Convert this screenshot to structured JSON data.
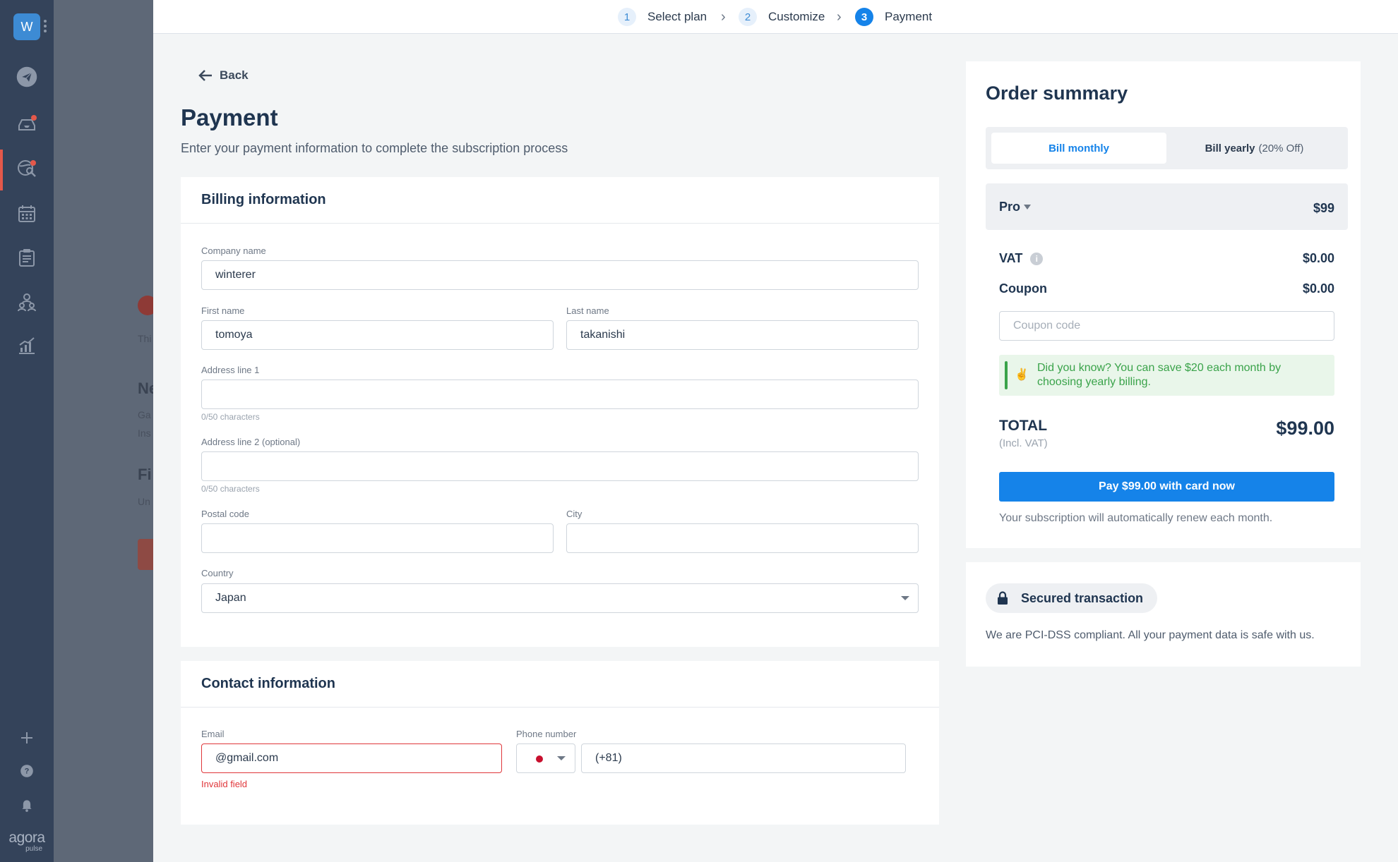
{
  "left_nav": {
    "workspace_initial": "W",
    "brand": "agora",
    "brand_sub": "pulse",
    "icons": [
      "paper-plane-icon",
      "inbox-icon",
      "listening-icon",
      "calendar-icon",
      "report-icon",
      "team-icon",
      "analytics-icon",
      "plus-icon",
      "help-icon",
      "bell-icon"
    ]
  },
  "background_page": {
    "fragments": [
      "Thi",
      "Ne",
      "Ga",
      "Ins",
      "Fi",
      "Un"
    ]
  },
  "stepper": {
    "steps": [
      {
        "number": "1",
        "label": "Select plan"
      },
      {
        "number": "2",
        "label": "Customize"
      },
      {
        "number": "3",
        "label": "Payment"
      }
    ],
    "active_step": 3
  },
  "header": {
    "back_label": "Back",
    "title": "Payment",
    "subtitle": "Enter your payment information to complete the subscription process"
  },
  "billing": {
    "heading": "Billing information",
    "company_name": {
      "label": "Company name",
      "value": "winterer"
    },
    "first_name": {
      "label": "First name",
      "value": "tomoya"
    },
    "last_name": {
      "label": "Last name",
      "value": "takanishi"
    },
    "address1": {
      "label": "Address line 1",
      "value": "",
      "hint": "0/50 characters"
    },
    "address2": {
      "label": "Address line 2 (optional)",
      "value": "",
      "hint": "0/50 characters"
    },
    "postal_code": {
      "label": "Postal code",
      "value": ""
    },
    "city": {
      "label": "City",
      "value": ""
    },
    "country": {
      "label": "Country",
      "value": "Japan"
    }
  },
  "contact": {
    "heading": "Contact information",
    "email": {
      "label": "Email",
      "value": "@gmail.com",
      "error": "Invalid field"
    },
    "phone": {
      "label": "Phone number",
      "value": "(+81)"
    }
  },
  "summary": {
    "title": "Order summary",
    "bill_monthly": "Bill monthly",
    "bill_yearly": "Bill yearly",
    "bill_yearly_discount": "(20% Off)",
    "plan_name": "Pro",
    "plan_price": "$99",
    "vat_label": "VAT",
    "vat_value": "$0.00",
    "coupon_label": "Coupon",
    "coupon_value": "$0.00",
    "coupon_placeholder": "Coupon code",
    "tip_emoji": "✌",
    "tip_text": "Did you know? You can save $20 each month by choosing yearly billing.",
    "total_label": "TOTAL",
    "total_sub": "(Incl. VAT)",
    "total_amount": "$99.00",
    "pay_button": "Pay $99.00 with card now",
    "renew_note": "Your subscription will automatically renew each month."
  },
  "security": {
    "badge": "Secured transaction",
    "note": "We are PCI-DSS compliant. All your payment data is safe with us."
  },
  "colors": {
    "accent": "#1583e9",
    "nav_bg": "#34435a",
    "error": "#e0363a",
    "success": "#3aa34a"
  }
}
